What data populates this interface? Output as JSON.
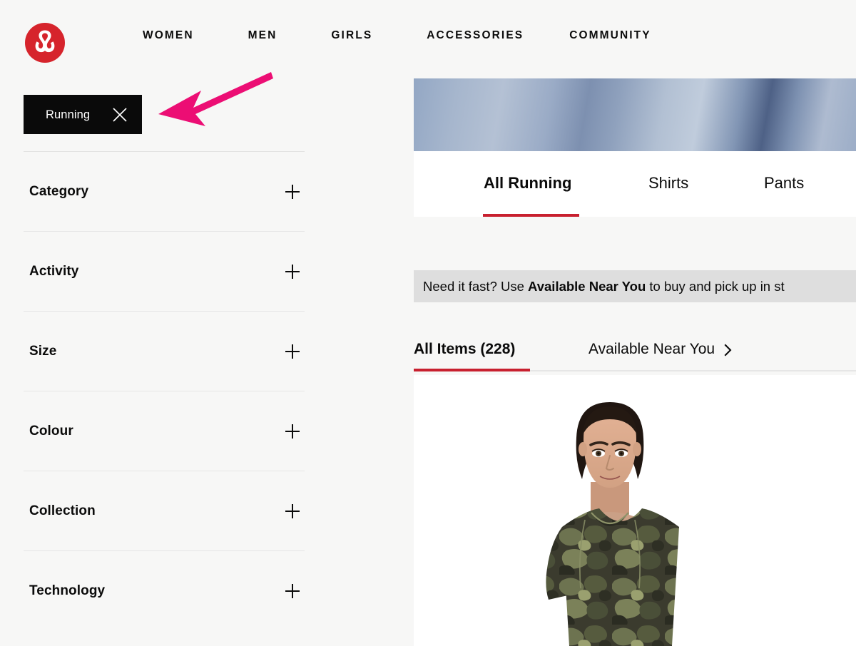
{
  "brand": {
    "logo_icon": "lululemon-logo-icon",
    "logo_color": "#d6242c"
  },
  "header": {
    "nav_items": [
      {
        "label": "WOMEN"
      },
      {
        "label": "MEN"
      },
      {
        "label": "GIRLS"
      },
      {
        "label": "ACCESSORIES"
      },
      {
        "label": "COMMUNITY"
      }
    ]
  },
  "sidebar": {
    "active_filter_chip": {
      "label": "Running",
      "close_icon": "close-x-icon",
      "background": "#0a0a0a",
      "text_color": "#ffffff"
    },
    "filter_sections": [
      {
        "label": "Category",
        "expand_icon": "plus-icon"
      },
      {
        "label": "Activity",
        "expand_icon": "plus-icon"
      },
      {
        "label": "Size",
        "expand_icon": "plus-icon"
      },
      {
        "label": "Colour",
        "expand_icon": "plus-icon"
      },
      {
        "label": "Collection",
        "expand_icon": "plus-icon"
      },
      {
        "label": "Technology",
        "expand_icon": "plus-icon"
      }
    ]
  },
  "main": {
    "hero_banner": {
      "alt": "blue-grey fabric banner image"
    },
    "category_tabs": [
      {
        "label": "All Running",
        "active": true
      },
      {
        "label": "Shirts",
        "active": false
      },
      {
        "label": "Pants",
        "active": false
      }
    ],
    "active_tab_accent": "#c8202f",
    "notice": {
      "text_before": "Need it fast? Use ",
      "text_bold": "Available Near You",
      "text_after": " to buy and pick up in st",
      "background": "#dedede"
    },
    "item_tabs": [
      {
        "label": "All Items (228)",
        "active": true
      },
      {
        "label": "Available Near You",
        "active": false,
        "chevron_icon": "chevron-right-icon"
      }
    ],
    "item_count": "228",
    "product": {
      "alt": "model wearing camo short-sleeve running shirt"
    }
  },
  "annotation": {
    "arrow_icon": "pink-pointer-arrow-icon",
    "color": "#ec0e74",
    "points_to": "Running"
  }
}
